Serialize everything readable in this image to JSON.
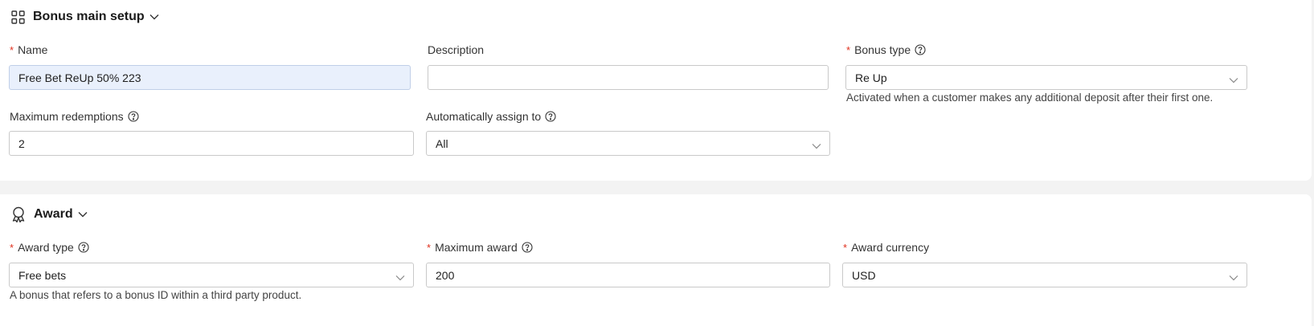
{
  "bonus_main_setup": {
    "title": "Bonus main setup",
    "name": {
      "label": "Name",
      "value": "Free Bet ReUp 50% 223"
    },
    "description": {
      "label": "Description",
      "value": ""
    },
    "bonus_type": {
      "label": "Bonus type",
      "value": "Re Up",
      "hint": "Activated when a customer makes any additional deposit after their first one."
    },
    "max_redemptions": {
      "label": "Maximum redemptions",
      "value": "2"
    },
    "auto_assign": {
      "label": "Automatically assign to",
      "value": "All"
    }
  },
  "award": {
    "title": "Award",
    "award_type": {
      "label": "Award type",
      "value": "Free bets",
      "hint": "A bonus that refers to a bonus ID within a third party product."
    },
    "max_award": {
      "label": "Maximum award",
      "value": "200"
    },
    "award_currency": {
      "label": "Award currency",
      "value": "USD"
    }
  },
  "required_marker": "*",
  "icons": {
    "section1": "grid-icon",
    "section2": "award-ribbon-icon",
    "collapse": "chevron-down-icon",
    "help": "help-circle-icon",
    "dropdown": "chevron-down-icon"
  },
  "colors": {
    "required": "#e0301e",
    "filled_input_bg": "#e9f0fc",
    "page_bg": "#f3f3f3"
  }
}
